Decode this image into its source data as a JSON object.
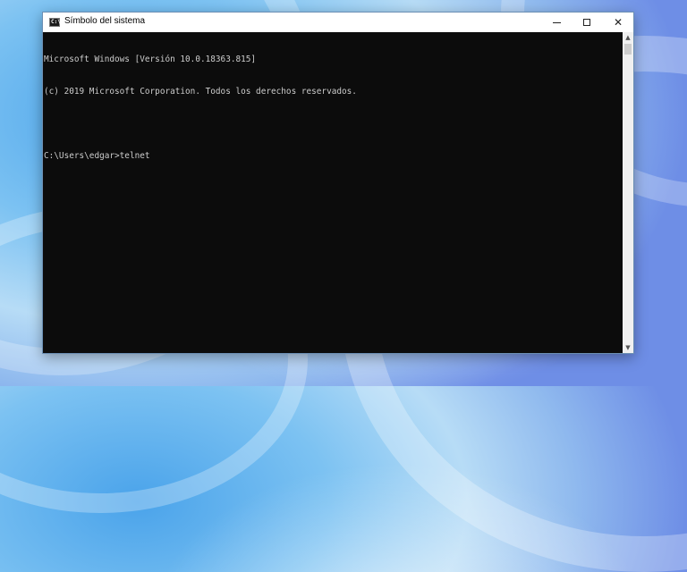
{
  "window": {
    "title": "Símbolo del sistema",
    "icon": "C:\\"
  },
  "controls": {
    "minimize": "minimize",
    "maximize": "maximize",
    "close": "✕"
  },
  "console": {
    "lines": [
      "Microsoft Windows [Versión 10.0.18363.815]",
      "(c) 2019 Microsoft Corporation. Todos los derechos reservados.",
      "",
      "C:\\Users\\edgar>telnet"
    ]
  },
  "colors": {
    "console_bg": "#0c0c0c",
    "console_text": "#cccccc"
  }
}
